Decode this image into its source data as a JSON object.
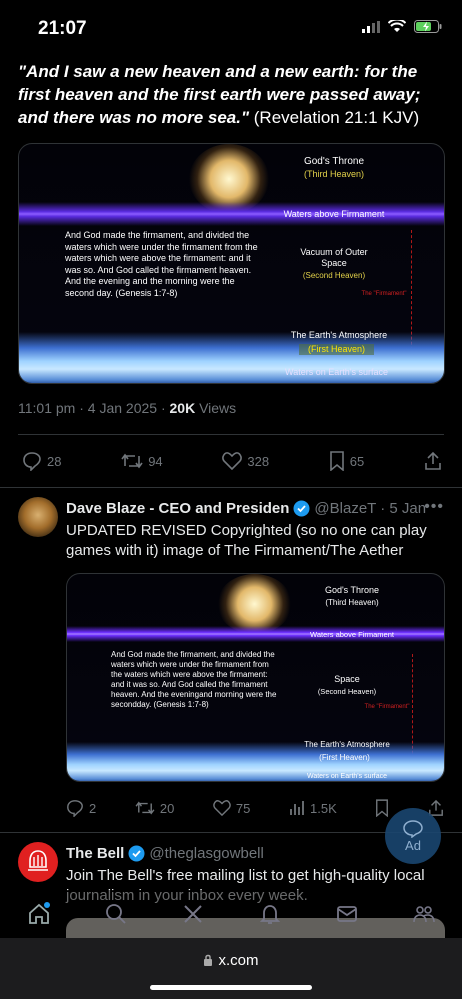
{
  "status": {
    "time": "21:07"
  },
  "quote": {
    "italic": "\"And I saw a new heaven and a new earth: for the first heaven and the first earth were passed away; and there was no more sea.\"",
    "ref": "(Revelation 21:1 KJV)"
  },
  "image1": {
    "throne": "God's Throne",
    "third_heaven": "(Third Heaven)",
    "waters_above": "Waters above Firmament",
    "body": "And God made the firmament, and divided the waters which were under the firmament from the waters which were above the firmament: and it was so. And God called the firmament heaven. And the evening and the morning were the second day. (Genesis 1:7-8)",
    "vacuum": "Vacuum of Outer Space",
    "second_heaven": "(Second Heaven)",
    "the_firmament": "The \"Firmament\"",
    "atmosphere": "The Earth's Atmosphere",
    "first_heaven": "(First Heaven)",
    "waters_surface": "Waters on Earth's surface"
  },
  "tweet1": {
    "timestamp": "11:01 pm · 4 Jan 2025 · ",
    "views_count": "20K",
    "views_label": " Views",
    "replies": "28",
    "reposts": "94",
    "likes": "328",
    "bookmarks": "65"
  },
  "tweet2": {
    "name": "Dave Blaze - CEO and Presiden",
    "handle": "@BlazeT · 5 Jan",
    "text": "UPDATED REVISED Copyrighted (so no one can play games with it) image of The Firmament/The Aether",
    "replies": "2",
    "reposts": "20",
    "likes": "75",
    "views": "1.5K"
  },
  "image2": {
    "throne": "God's Throne",
    "third_heaven": "(Third Heaven)",
    "waters_above": "Waters above Firmament",
    "body": "And God made the firmament, and divided the waters which were under the firmament from the waters which were above the firmament: and it was so. And God called the firmament heaven. And the eveningand morning were the secondday. (Genesis 1:7-8)",
    "space": "Space",
    "second_heaven": "(Second Heaven)",
    "the_firmament": "The \"Firmament\"",
    "atmosphere": "The Earth's Atmosphere",
    "first_heaven": "(First Heaven)",
    "waters_surface": "Waters on Earth's surface"
  },
  "tweet3": {
    "name": "The Bell",
    "handle": "@theglasgowbell",
    "text": "Join The Bell's free mailing list to get high-quality local journalism in your inbox every week."
  },
  "ad": {
    "label": "Ad"
  },
  "browser": {
    "url": "x.com"
  },
  "colors": {
    "accent": "#1d9bf0",
    "muted": "#71767b",
    "bg": "#000000"
  }
}
